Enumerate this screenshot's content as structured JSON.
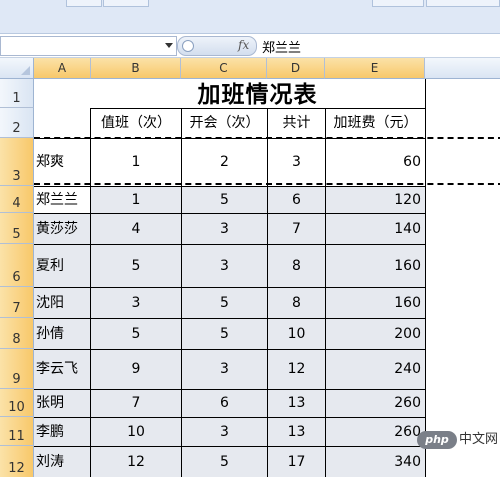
{
  "formula_bar": {
    "fx_label": "fx",
    "content": "郑兰兰"
  },
  "columns": [
    "A",
    "B",
    "C",
    "D",
    "E"
  ],
  "rows": [
    "1",
    "2",
    "3",
    "4",
    "5",
    "6",
    "7",
    "8",
    "9",
    "10",
    "11",
    "12"
  ],
  "sheet": {
    "title": "加班情况表",
    "headers": [
      "",
      "值班（次）",
      "开会（次）",
      "共计",
      "加班费（元）"
    ],
    "data": [
      [
        "郑爽",
        "1",
        "2",
        "3",
        "60"
      ],
      [
        "郑兰兰",
        "1",
        "5",
        "6",
        "120"
      ],
      [
        "黄莎莎",
        "4",
        "3",
        "7",
        "140"
      ],
      [
        "夏利",
        "5",
        "3",
        "8",
        "160"
      ],
      [
        "沈阳",
        "3",
        "5",
        "8",
        "160"
      ],
      [
        "孙倩",
        "5",
        "5",
        "10",
        "200"
      ],
      [
        "李云飞",
        "9",
        "3",
        "12",
        "240"
      ],
      [
        "张明",
        "7",
        "6",
        "13",
        "260"
      ],
      [
        "李鹏",
        "10",
        "3",
        "13",
        "260"
      ],
      [
        "刘涛",
        "12",
        "5",
        "17",
        "340"
      ]
    ]
  },
  "watermark": {
    "logo": "php",
    "text": "中文网"
  },
  "colors": {
    "header_highlight": "#f8c86a",
    "gridline": "#000000",
    "selection_fill": "#e6e9ef"
  }
}
